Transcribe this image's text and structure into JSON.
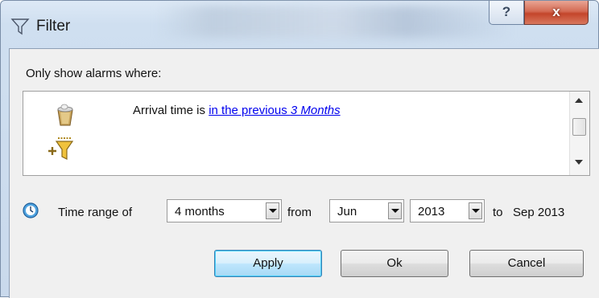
{
  "window": {
    "title": "Filter",
    "help_label": "?",
    "close_label": "x"
  },
  "filter": {
    "prompt": "Only show alarms where:",
    "condition": {
      "prefix": "Arrival time is ",
      "link_text": "in the previous ",
      "link_value": "3 Months"
    }
  },
  "time_range": {
    "label": "Time range of",
    "duration": "4 months",
    "from_label": "from",
    "from_month": "Jun",
    "from_year": "2013",
    "to_label": "to",
    "to_value": "Sep 2013"
  },
  "buttons": {
    "apply": "Apply",
    "ok": "Ok",
    "cancel": "Cancel"
  },
  "colors": {
    "link": "#0000ee",
    "close_button": "#c4452b",
    "default_button_border": "#3c7fb1"
  }
}
